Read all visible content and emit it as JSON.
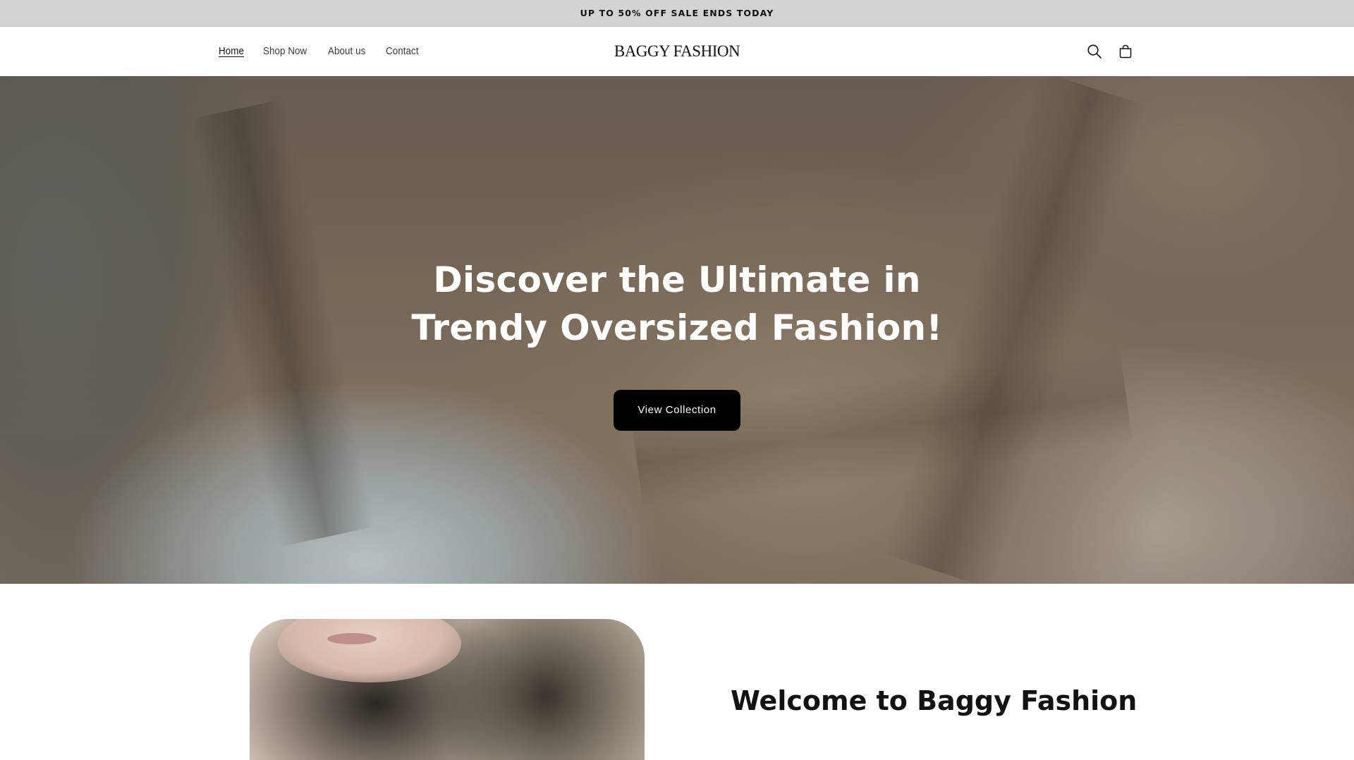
{
  "announcement": {
    "text": "UP TO 50% OFF SALE ENDS TODAY"
  },
  "header": {
    "nav": [
      {
        "label": "Home",
        "active": true
      },
      {
        "label": "Shop Now",
        "active": false
      },
      {
        "label": "About us",
        "active": false
      },
      {
        "label": "Contact",
        "active": false
      }
    ],
    "logo": "BAGGY FASHION",
    "icons": [
      "search-icon",
      "cart-icon"
    ]
  },
  "hero": {
    "title": "Discover the Ultimate in Trendy Oversized Fashion!",
    "button_label": "View Collection"
  },
  "welcome": {
    "title": "Welcome to Baggy Fashion"
  }
}
